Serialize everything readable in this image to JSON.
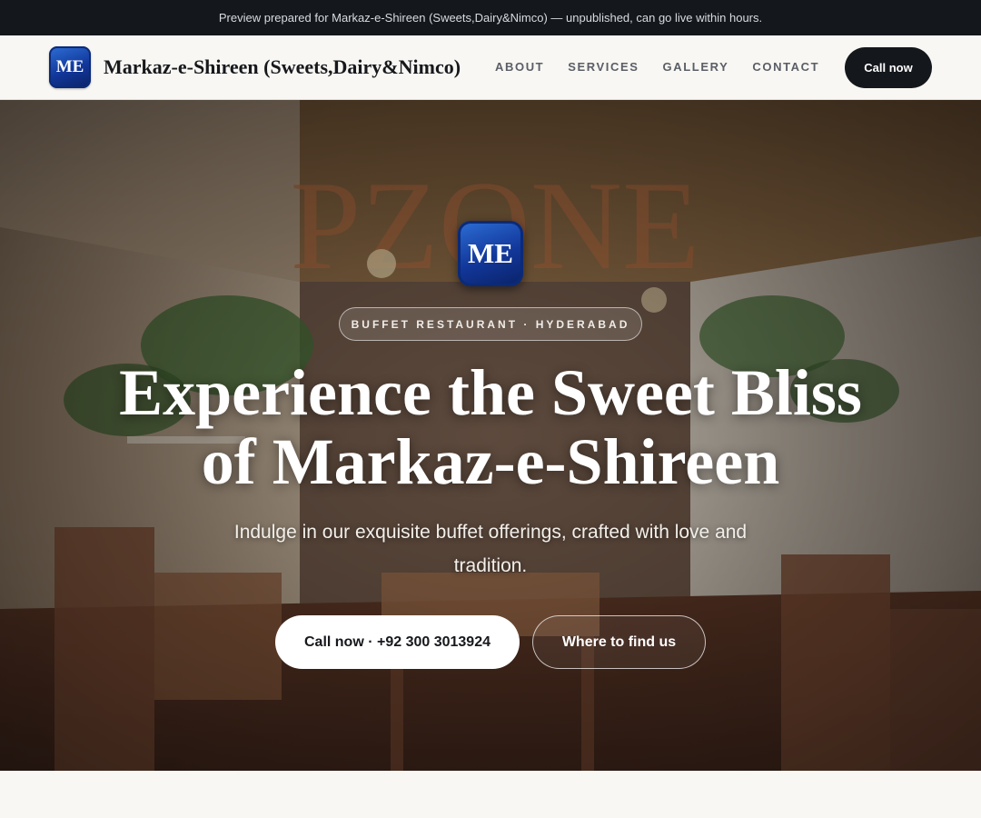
{
  "preview_bar": {
    "text": "Preview prepared for Markaz-e-Shireen (Sweets,Dairy&Nimco) — unpublished, can go live within hours."
  },
  "header": {
    "logo_text": "ME",
    "brand_name": "Markaz-e-Shireen (Sweets,Dairy&Nimco)",
    "nav": [
      {
        "label": "ABOUT"
      },
      {
        "label": "SERVICES"
      },
      {
        "label": "GALLERY"
      },
      {
        "label": "CONTACT"
      }
    ],
    "cta_label": "Call now"
  },
  "hero": {
    "logo_text": "ME",
    "eyebrow": "BUFFET RESTAURANT · HYDERABAD",
    "title_line1": "Experience the Sweet Bliss",
    "title_line2": "of Markaz-e-Shireen",
    "subtitle": "Indulge in our exquisite buffet offerings, crafted with love and tradition.",
    "primary_button": "Call now · +92 300 3013924",
    "secondary_button": "Where to find us",
    "background_image": "restaurant-interior-photo"
  },
  "colors": {
    "dark": "#14171b",
    "page_bg": "#f8f7f3",
    "brand_blue": "#12379a"
  }
}
